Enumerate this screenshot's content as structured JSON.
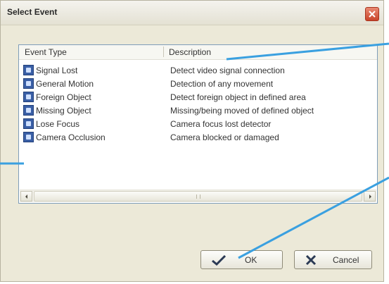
{
  "dialog": {
    "title": "Select Event"
  },
  "list": {
    "columns": {
      "type": "Event Type",
      "description": "Description"
    },
    "rows": [
      {
        "type": "Signal Lost",
        "description": "Detect video signal connection"
      },
      {
        "type": "General Motion",
        "description": "Detection of any movement"
      },
      {
        "type": "Foreign Object",
        "description": "Detect foreign object in defined area"
      },
      {
        "type": "Missing Object",
        "description": "Missing/being moved of defined object"
      },
      {
        "type": "Lose Focus",
        "description": "Camera focus lost detector"
      },
      {
        "type": "Camera Occlusion",
        "description": "Camera blocked or damaged"
      }
    ]
  },
  "buttons": {
    "ok": "OK",
    "cancel": "Cancel"
  },
  "colors": {
    "callout_line": "#3aa0e0",
    "close_button": "#d0482e"
  }
}
